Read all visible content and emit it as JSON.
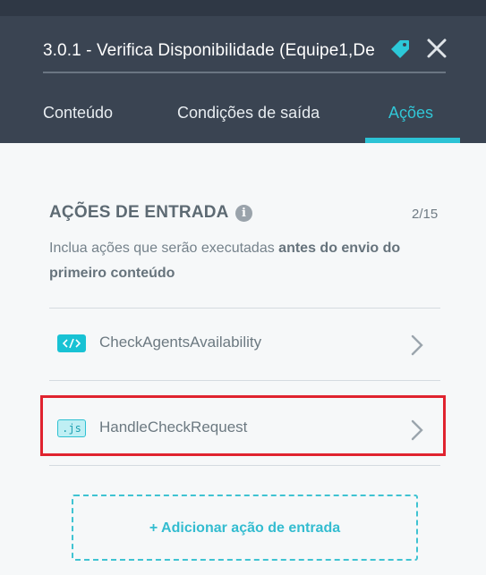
{
  "header": {
    "title": "3.0.1 - Verifica Disponibilidade (Equipe1,De",
    "tag_icon": "tag-icon",
    "close_icon": "close-icon"
  },
  "tabs": [
    {
      "label": "Conteúdo",
      "active": false
    },
    {
      "label": "Condições de saída",
      "active": false
    },
    {
      "label": "Ações",
      "active": true
    }
  ],
  "section": {
    "title": "AÇÕES DE ENTRADA",
    "info_icon": "info-icon",
    "counter": "2/15",
    "description_prefix": "Inclua ações que serão executadas ",
    "description_bold": "antes do envio do primeiro conteúdo"
  },
  "actions": [
    {
      "label": "CheckAgentsAvailability",
      "icon": "code-icon",
      "badge_text": "</>"
    },
    {
      "label": "HandleCheckRequest",
      "icon": "js-icon",
      "badge_text": ".js"
    }
  ],
  "add_button": {
    "label": "+ Adicionar ação de entrada"
  },
  "colors": {
    "header_bg": "#3a4452",
    "accent": "#2cc3d5",
    "highlight": "#e0232f",
    "body_bg": "#f6f8f9"
  }
}
